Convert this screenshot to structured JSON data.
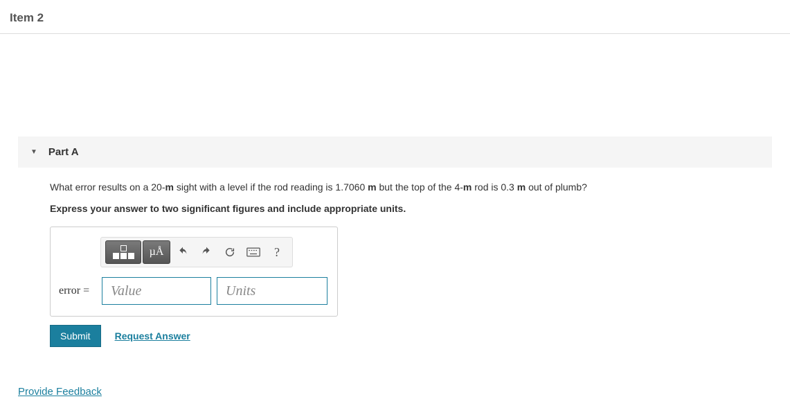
{
  "header": {
    "item_title": "Item 2"
  },
  "part": {
    "title": "Part A",
    "question_prefix": "What error results on a 20-",
    "unit1": "m",
    "question_mid1": " sight with a level if the rod reading is 1.7060 ",
    "unit2": "m",
    "question_mid2": " but the top of the 4-",
    "unit3": "m",
    "question_mid3": " rod is 0.3 ",
    "unit4": "m",
    "question_suffix": " out of plumb?",
    "instruction": "Express your answer to two significant figures and include appropriate units."
  },
  "answer": {
    "label": "error =",
    "value_placeholder": "Value",
    "units_placeholder": "Units",
    "toolbar": {
      "mu_label": "µÅ",
      "help_label": "?"
    }
  },
  "actions": {
    "submit": "Submit",
    "request_answer": "Request Answer"
  },
  "feedback": {
    "label": "Provide Feedback"
  }
}
